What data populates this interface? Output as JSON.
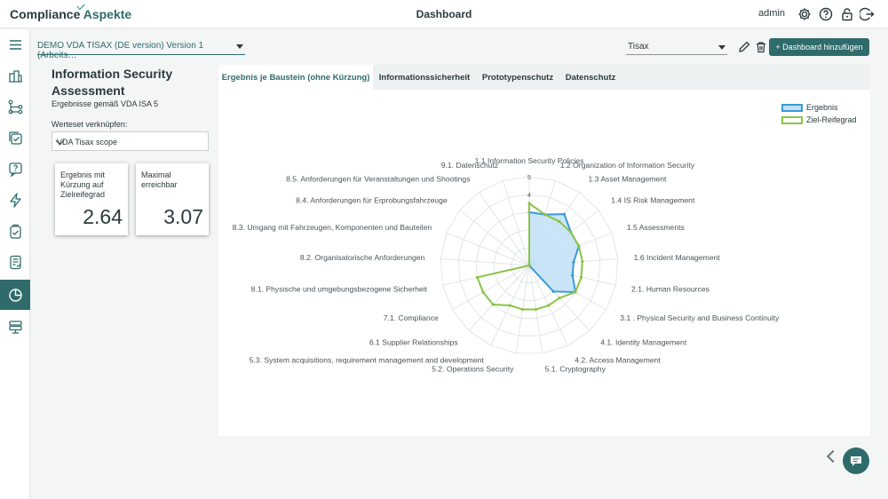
{
  "header": {
    "logo_main": "Compliance",
    "logo_accent": "Aspekte",
    "title": "Dashboard",
    "user": "admin",
    "icons": [
      "gear-icon",
      "help-icon",
      "lock-icon",
      "logout-icon"
    ]
  },
  "sidebar": {
    "items": [
      {
        "name": "menu-icon",
        "active": false
      },
      {
        "name": "organization-icon",
        "active": false
      },
      {
        "name": "structure-icon",
        "active": false
      },
      {
        "name": "tasks-icon",
        "active": false
      },
      {
        "name": "questions-icon",
        "active": false
      },
      {
        "name": "lightning-icon",
        "active": false
      },
      {
        "name": "clipboard-icon",
        "active": false
      },
      {
        "name": "report-icon",
        "active": false
      },
      {
        "name": "chart-pie-icon",
        "active": true
      },
      {
        "name": "database-icon",
        "active": false
      }
    ]
  },
  "toolbar": {
    "dashboard_select": "DEMO VDA TISAX (DE version) Version 1 (Arbeits…",
    "filter_select": "Tisax",
    "add_button": "+ Dashboard hinzufügen"
  },
  "left": {
    "title": "Information Security Assessment",
    "subtitle": "Ergebnisse gemäß VDA ISA 5",
    "werteset_label": "Werteset verknüpfen:",
    "werteset_value": "VDA Tisax scope",
    "kpi1": {
      "label": "Ergebnis mit Kürzung auf Zielreifegrad",
      "value": "2.64"
    },
    "kpi2": {
      "label": "Maximal erreichbar",
      "value": "3.07"
    }
  },
  "tabs": [
    {
      "label": "Ergebnis je Baustein (ohne Kürzung)",
      "active": true
    },
    {
      "label": "Informationssicherheit",
      "active": false
    },
    {
      "label": "Prototypenschutz",
      "active": false
    },
    {
      "label": "Datenschutz",
      "active": false
    }
  ],
  "chart_data": {
    "type": "radar",
    "categories": [
      "1.1 Information Security Policies",
      "1.2 Organization of Information Security",
      "1.3 Asset Management",
      "1.4 IS Risk Management",
      "1.5 Assessments",
      "1.6 Incident Management",
      "2.1. Human Resources",
      "3.1 . Physical Security and Business Continuity",
      "4.1. Identity Management",
      "4.2. Access Management",
      "5.1. Cryptography",
      "5.2. Operations Security",
      "5.3. System acquisitions, requirement management and development",
      "6.1 Supplier Relationships",
      "7.1. Compliance",
      "8.1. Physische und umgebungsbezogene Sicherheit",
      "8.2. Organisatorische Anforderungen",
      "8.3. Umgang mit Fahrzeugen, Komponenten und Bauteilen",
      "8.4. Anforderungen für Erprobungsfahrzeuge",
      "8.5. Anforderungen für Veranstaltungen und Shootings",
      "9.1. Datenschutz"
    ],
    "rlim": [
      0,
      5
    ],
    "ticks": [
      "4",
      "5"
    ],
    "legend_position": "top-right",
    "series": [
      {
        "name": "Ergebnis",
        "color": "#3a9ad9",
        "fill": "#bfe0f6",
        "values": [
          3,
          3,
          3.5,
          3,
          3,
          2.5,
          2.5,
          3,
          2,
          0,
          0,
          0,
          0,
          0,
          0,
          0,
          0,
          0,
          0,
          0,
          0
        ]
      },
      {
        "name": "Ziel-Reifegrad",
        "color": "#8bc34a",
        "fill": "none",
        "values": [
          3.5,
          3,
          3,
          3,
          3,
          3,
          3,
          3,
          2.5,
          2.5,
          2.5,
          2.5,
          2.5,
          3,
          3,
          3,
          0,
          0,
          0,
          0,
          0
        ]
      }
    ]
  }
}
